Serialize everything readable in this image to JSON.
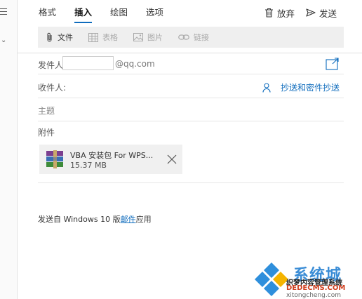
{
  "menu": {
    "tabs": [
      {
        "label": "格式",
        "active": false
      },
      {
        "label": "插入",
        "active": true
      },
      {
        "label": "绘图",
        "active": false
      },
      {
        "label": "选项",
        "active": false
      }
    ],
    "discard_label": "放弃",
    "send_label": "发送"
  },
  "toolbar": {
    "items": [
      {
        "label": "文件",
        "icon": "paperclip-icon",
        "enabled": true
      },
      {
        "label": "表格",
        "icon": "table-icon",
        "enabled": false
      },
      {
        "label": "图片",
        "icon": "picture-icon",
        "enabled": false
      },
      {
        "label": "链接",
        "icon": "link-icon",
        "enabled": false
      }
    ]
  },
  "compose": {
    "from_label": "发件人",
    "from_value": "",
    "from_domain": "@qq.com",
    "to_label": "收件人:",
    "cc_bcc_label": "抄送和密件抄送",
    "subject_placeholder": "主题",
    "attachments_label": "附件",
    "attachment": {
      "name": "VBA 安装包 For WPS...",
      "size": "15.37 MB",
      "icon": "archive-icon"
    },
    "signature_prefix": "发送自 Windows 10 版",
    "signature_link": "邮件",
    "signature_suffix": "应用"
  },
  "watermark": {
    "brand": "系统城",
    "line1": "织梦内容管理系统",
    "line2": "DEDECMS.COM",
    "line3": "xitongcheng.com"
  },
  "colors": {
    "accent": "#0f6cbd",
    "toolbar_bg": "#efefef",
    "attachment_bg": "#f0f0f0"
  }
}
